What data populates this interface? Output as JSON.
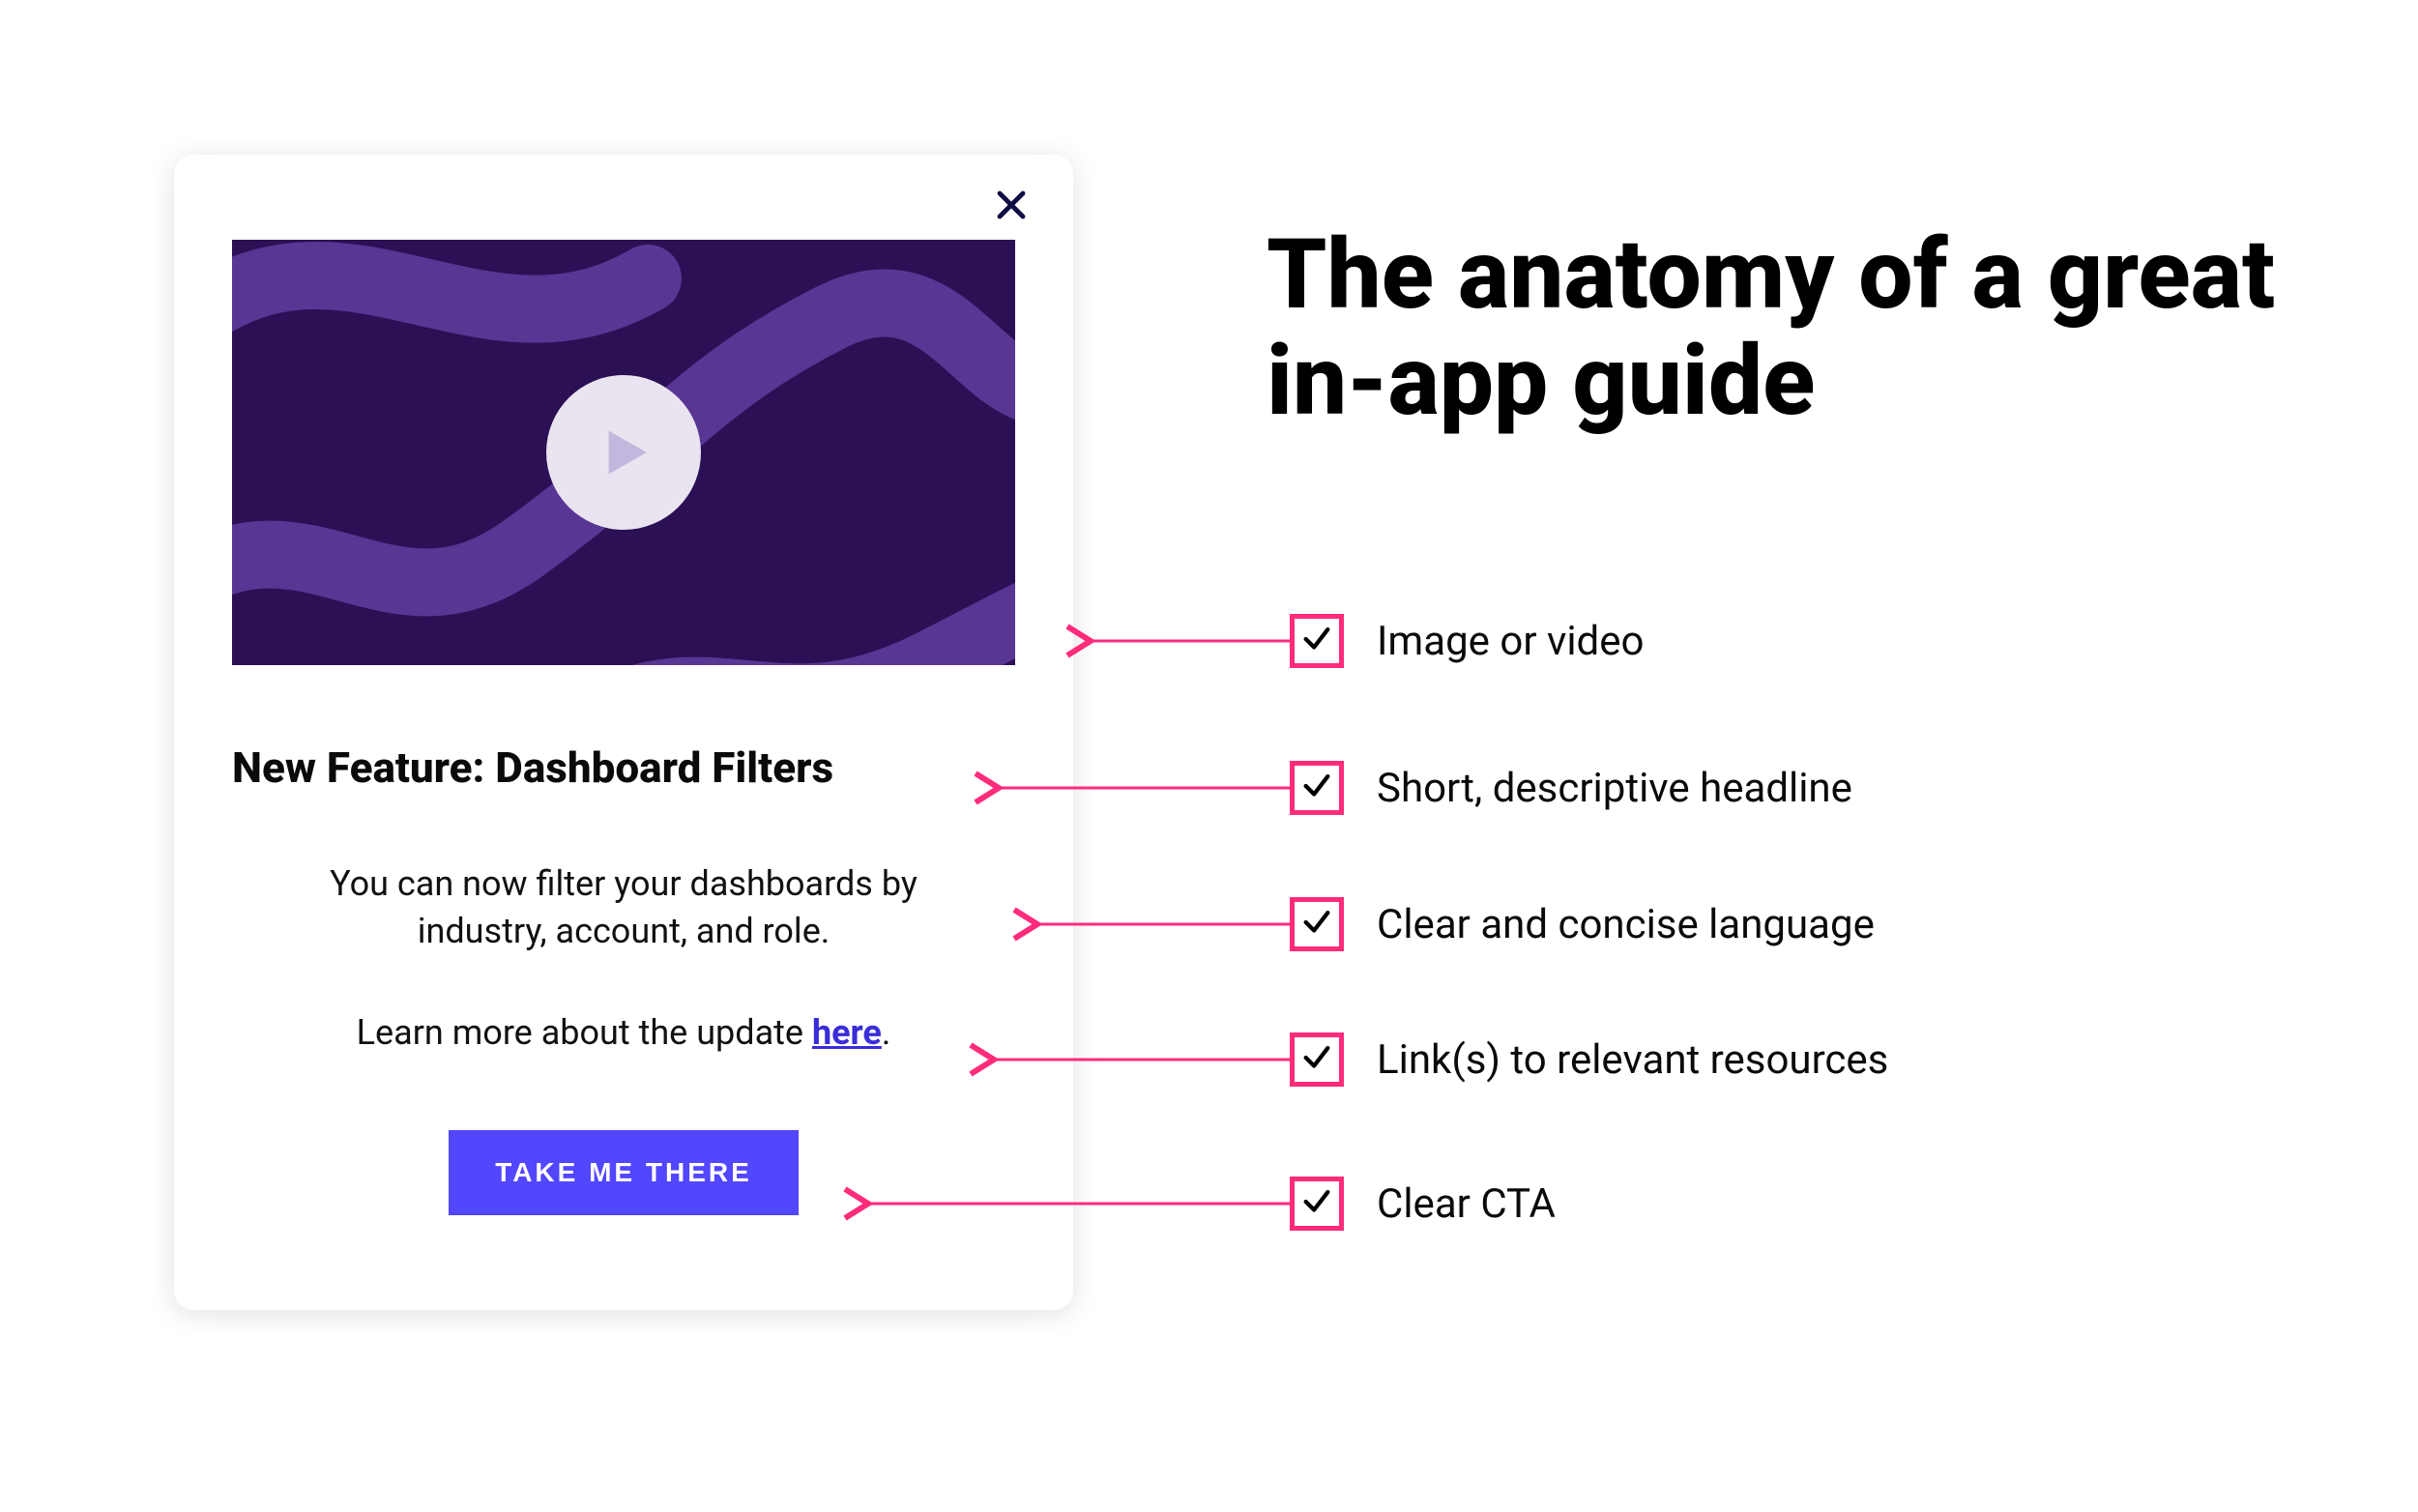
{
  "title": "The anatomy of a great in-app guide",
  "card": {
    "headline": "New Feature: Dashboard Filters",
    "body": "You can now filter your dashboards by industry, account, and role.",
    "learn_prefix": "Learn more about the update ",
    "learn_link_text": "here",
    "learn_suffix": ".",
    "cta_label": "TAKE ME THERE"
  },
  "checklist": [
    "Image or video",
    "Short, descriptive headline",
    "Clear and concise language",
    "Link(s) to relevant resources",
    "Clear CTA"
  ],
  "colors": {
    "accent_pink": "#ff2b7b",
    "cta_blue": "#5246ff",
    "video_bg": "#2b1055",
    "link": "#3a2dd8"
  }
}
